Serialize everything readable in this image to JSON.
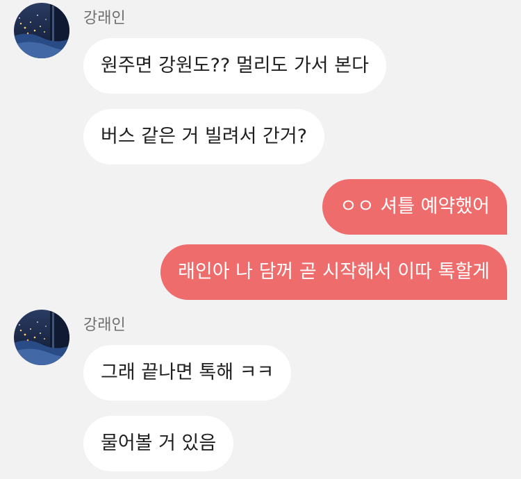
{
  "chat": {
    "groups": [
      {
        "sender": "강래인",
        "messages": [
          "원주면 강원도?? 멀리도 가서 본다",
          "버스 같은 거 빌려서 간거?"
        ]
      },
      {
        "outgoing": [
          "ㅇㅇ 셔틀 예약했어",
          "래인아 나 담꺼 곧 시작해서 이따 톡할게"
        ]
      },
      {
        "sender": "강래인",
        "messages": [
          "그래 끝나면 톡해 ㅋㅋ",
          "물어볼 거 있음"
        ]
      }
    ]
  },
  "colors": {
    "background": "#f2f2f2",
    "incoming_bubble": "#ffffff",
    "outgoing_bubble": "#ee6c6c"
  },
  "icons": {
    "avatar": "profile-photo-night-city-icon"
  }
}
